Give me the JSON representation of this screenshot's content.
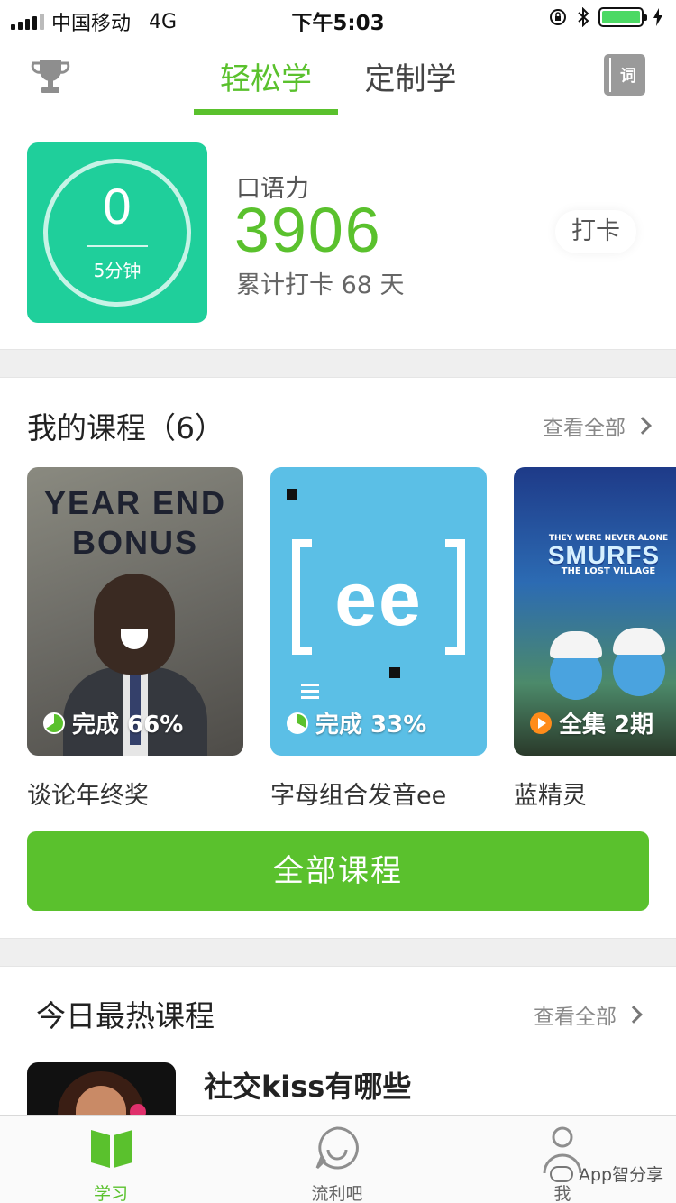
{
  "status_bar": {
    "carrier": "中国移动",
    "network": "4G",
    "time": "下午5:03"
  },
  "nav": {
    "tabs": [
      {
        "label": "轻松学",
        "active": true
      },
      {
        "label": "定制学",
        "active": false
      }
    ],
    "vocab_label": "词",
    "accent_color": "#5ac12d"
  },
  "stats": {
    "timer_value": "0",
    "timer_label": "5分钟",
    "metric_label": "口语力",
    "metric_value": "3906",
    "streak_text": "累计打卡 68 天",
    "checkin_label": "打卡"
  },
  "my_courses": {
    "title": "我的课程（6）",
    "view_all": "查看全部",
    "items": [
      {
        "name": "谈论年终奖",
        "progress_text": "完成 66%",
        "progress": 0.66,
        "poster_text": "YEAR END BONUS"
      },
      {
        "name": "字母组合发音ee",
        "progress_text": "完成 33%",
        "progress": 0.33,
        "poster_text": "ee"
      },
      {
        "name": "蓝精灵",
        "progress_text": "全集 2期",
        "poster_top": "THEY WERE NEVER ALONE",
        "poster_title": "SMURFS",
        "poster_sub": "THE LOST VILLAGE"
      }
    ],
    "all_button": "全部课程"
  },
  "hot_courses": {
    "title": "今日最热课程",
    "view_all": "查看全部",
    "first_title": "社交kiss有哪些"
  },
  "tab_bar": {
    "items": [
      {
        "label": "学习",
        "icon": "book-icon",
        "active": true
      },
      {
        "label": "流利吧",
        "icon": "smile-bubble-icon",
        "active": false
      },
      {
        "label": "我",
        "icon": "person-icon",
        "active": false
      }
    ]
  },
  "watermark": "App智分享"
}
